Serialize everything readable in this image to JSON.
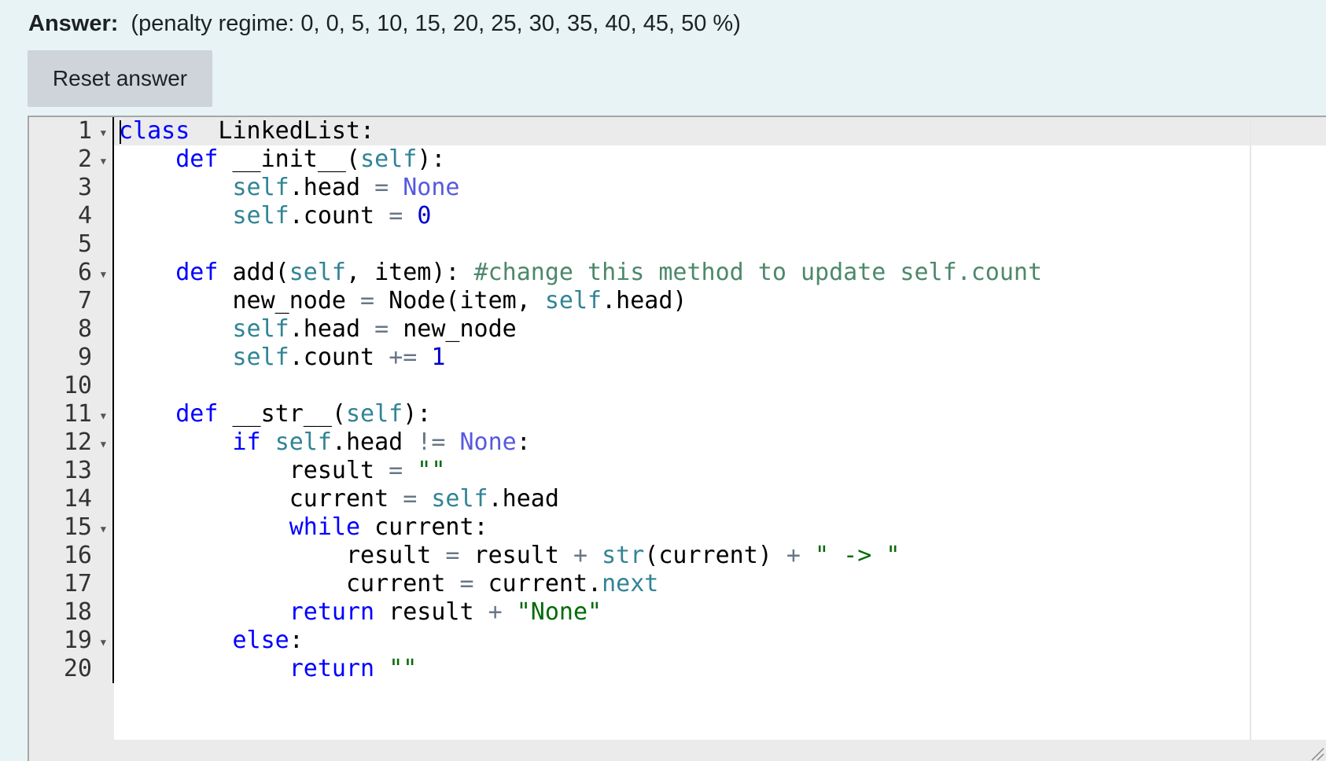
{
  "answer": {
    "label": "Answer:",
    "penalty_text": "(penalty regime: 0, 0, 5, 10, 15, 20, 25, 30, 35, 40, 45, 50 %)"
  },
  "reset_button": {
    "label": "Reset answer"
  },
  "editor": {
    "language": "python",
    "line_numbers": [
      "1",
      "2",
      "3",
      "4",
      "5",
      "6",
      "7",
      "8",
      "9",
      "10",
      "11",
      "12",
      "13",
      "14",
      "15",
      "16",
      "17",
      "18",
      "19",
      "20"
    ],
    "fold_markers_on_lines": [
      1,
      2,
      6,
      11,
      12,
      15,
      19
    ],
    "lines": [
      [
        [
          "kw",
          "class"
        ],
        [
          "",
          "  LinkedList:"
        ]
      ],
      [
        [
          "",
          "    "
        ],
        [
          "kw",
          "def"
        ],
        [
          "",
          " __init__("
        ],
        [
          "slf",
          "self"
        ],
        [
          "",
          "):"
        ]
      ],
      [
        [
          "",
          "        "
        ],
        [
          "slf",
          "self"
        ],
        [
          "",
          ".head "
        ],
        [
          "op",
          "="
        ],
        [
          "",
          " "
        ],
        [
          "cons",
          "None"
        ]
      ],
      [
        [
          "",
          "        "
        ],
        [
          "slf",
          "self"
        ],
        [
          "",
          ".count "
        ],
        [
          "op",
          "="
        ],
        [
          "",
          " "
        ],
        [
          "num",
          "0"
        ]
      ],
      [
        [
          "",
          ""
        ]
      ],
      [
        [
          "",
          "    "
        ],
        [
          "kw",
          "def"
        ],
        [
          "",
          " add("
        ],
        [
          "slf",
          "self"
        ],
        [
          "",
          ", item): "
        ],
        [
          "cmt",
          "#change this method to update self.count"
        ]
      ],
      [
        [
          "",
          "        new_node "
        ],
        [
          "op",
          "="
        ],
        [
          "",
          " Node(item, "
        ],
        [
          "slf",
          "self"
        ],
        [
          "",
          ".head)"
        ]
      ],
      [
        [
          "",
          "        "
        ],
        [
          "slf",
          "self"
        ],
        [
          "",
          ".head "
        ],
        [
          "op",
          "="
        ],
        [
          "",
          " new_node"
        ]
      ],
      [
        [
          "",
          "        "
        ],
        [
          "slf",
          "self"
        ],
        [
          "",
          ".count "
        ],
        [
          "op",
          "+="
        ],
        [
          "",
          " "
        ],
        [
          "num",
          "1"
        ]
      ],
      [
        [
          "",
          ""
        ]
      ],
      [
        [
          "",
          "    "
        ],
        [
          "kw",
          "def"
        ],
        [
          "",
          " __str__("
        ],
        [
          "slf",
          "self"
        ],
        [
          "",
          "):"
        ]
      ],
      [
        [
          "",
          "        "
        ],
        [
          "kw",
          "if"
        ],
        [
          "",
          " "
        ],
        [
          "slf",
          "self"
        ],
        [
          "",
          ".head "
        ],
        [
          "op",
          "!="
        ],
        [
          "",
          " "
        ],
        [
          "cons",
          "None"
        ],
        [
          "",
          ":"
        ]
      ],
      [
        [
          "",
          "            result "
        ],
        [
          "op",
          "="
        ],
        [
          "",
          " "
        ],
        [
          "str",
          "\"\""
        ]
      ],
      [
        [
          "",
          "            current "
        ],
        [
          "op",
          "="
        ],
        [
          "",
          " "
        ],
        [
          "slf",
          "self"
        ],
        [
          "",
          ".head"
        ]
      ],
      [
        [
          "",
          "            "
        ],
        [
          "kw",
          "while"
        ],
        [
          "",
          " current:"
        ]
      ],
      [
        [
          "",
          "                result "
        ],
        [
          "op",
          "="
        ],
        [
          "",
          " result "
        ],
        [
          "op",
          "+"
        ],
        [
          "",
          " "
        ],
        [
          "sup",
          "str"
        ],
        [
          "",
          "(current) "
        ],
        [
          "op",
          "+"
        ],
        [
          "",
          " "
        ],
        [
          "str",
          "\" -> \""
        ]
      ],
      [
        [
          "",
          "                current "
        ],
        [
          "op",
          "="
        ],
        [
          "",
          " current."
        ],
        [
          "sup",
          "next"
        ]
      ],
      [
        [
          "",
          "            "
        ],
        [
          "kw",
          "return"
        ],
        [
          "",
          " result "
        ],
        [
          "op",
          "+"
        ],
        [
          "",
          " "
        ],
        [
          "str",
          "\"None\""
        ]
      ],
      [
        [
          "",
          "        "
        ],
        [
          "kw",
          "else"
        ],
        [
          "",
          ":"
        ]
      ],
      [
        [
          "",
          "            "
        ],
        [
          "kw",
          "return"
        ],
        [
          "",
          " "
        ],
        [
          "str",
          "\"\""
        ]
      ]
    ]
  }
}
